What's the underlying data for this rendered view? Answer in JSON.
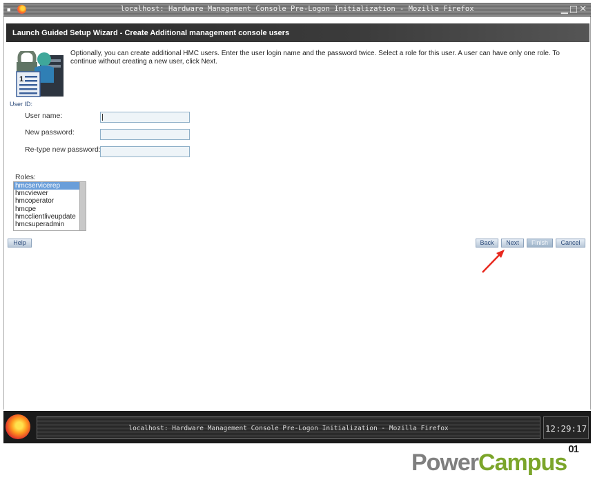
{
  "window": {
    "title": "localhost: Hardware Management Console Pre-Logon Initialization - Mozilla Firefox"
  },
  "wizard": {
    "heading": "Launch Guided Setup Wizard - Create Additional management console users",
    "description": "Optionally, you can create additional HMC users. Enter the user login name and the password twice. Select a role for this user. A user can have only one role. To continue without creating a new user, click Next.",
    "userid_label": "User ID:",
    "fields": {
      "username_label": "User name:",
      "username_value": "",
      "password_label": "New password:",
      "password_value": "",
      "retype_label": "Re-type new password:",
      "retype_value": ""
    },
    "roles_label": "Roles:",
    "roles": [
      "hmcservicerep",
      "hmcviewer",
      "hmcoperator",
      "hmcpe",
      "hmcclientliveupdate",
      "hmcsuperadmin"
    ],
    "selected_role": "hmcservicerep",
    "buttons": {
      "help": "Help",
      "back": "Back",
      "next": "Next",
      "finish": "Finish",
      "cancel": "Cancel"
    }
  },
  "taskbar": {
    "task_title": "localhost: Hardware Management Console Pre-Logon Initialization - Mozilla Firefox",
    "clock": "12:29:17"
  },
  "watermark": {
    "part1": "Power",
    "part2": "Campus",
    "sup": "01"
  },
  "colors": {
    "annotation_arrow": "#e8281e",
    "selected_role_bg": "#6a9ed9",
    "brand_green": "#7ba52a"
  }
}
